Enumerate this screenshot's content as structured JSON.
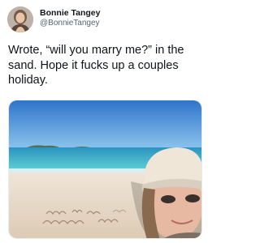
{
  "tweet": {
    "author": {
      "name": "Bonnie Tangey",
      "handle": "@BonnieTangey",
      "avatar_icon": "profile-photo-avatar"
    },
    "text": "Wrote, “will you marry me?” in the sand. Hope it fucks up a couples holiday.",
    "media": {
      "type": "photo",
      "alt": "selfie on a beach with a message written in the sand"
    }
  },
  "colors": {
    "text_primary": "#0f1419",
    "text_secondary": "#536471",
    "sky": "#3d86d6",
    "sea": "#2aa6c4",
    "sand": "#e9dccc"
  }
}
